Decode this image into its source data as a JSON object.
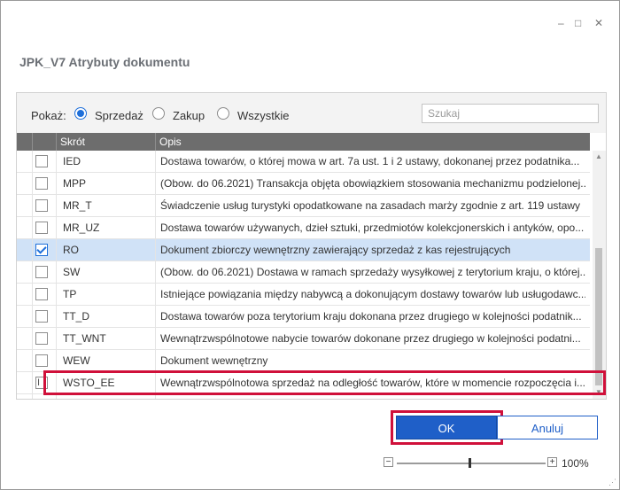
{
  "window": {
    "controls": [
      "–",
      "□",
      "✕"
    ],
    "title": "JPK_V7 Atrybuty dokumentu"
  },
  "filter": {
    "label": "Pokaż:",
    "options": [
      {
        "label": "Sprzedaż",
        "selected": true
      },
      {
        "label": "Zakup",
        "selected": false
      },
      {
        "label": "Wszystkie",
        "selected": false
      }
    ],
    "search_placeholder": "Szukaj"
  },
  "table": {
    "columns": [
      "Skrót",
      "Opis"
    ],
    "rows": [
      {
        "code": "IED",
        "desc": "Dostawa towarów, o której mowa w art. 7a ust. 1 i 2 ustawy, dokonanej przez podatnika...",
        "checked": false
      },
      {
        "code": "MPP",
        "desc": "(Obow. do 06.2021) Transakcja objęta obowiązkiem stosowania mechanizmu podzielonej...",
        "checked": false
      },
      {
        "code": "MR_T",
        "desc": "Świadczenie usług turystyki opodatkowane na zasadach marży zgodnie z art. 119 ustawy",
        "checked": false
      },
      {
        "code": "MR_UZ",
        "desc": "Dostawa towarów używanych, dzieł sztuki, przedmiotów kolekcjonerskich i antyków, opo...",
        "checked": false
      },
      {
        "code": "RO",
        "desc": "Dokument zbiorczy wewnętrzny zawierający sprzedaż z kas rejestrujących",
        "checked": true,
        "selected": true
      },
      {
        "code": "SW",
        "desc": "(Obow. do 06.2021) Dostawa w ramach sprzedaży wysyłkowej z terytorium kraju, o której...",
        "checked": false
      },
      {
        "code": "TP",
        "desc": "Istniejące powiązania między nabywcą a dokonującym dostawy towarów lub usługodawc...",
        "checked": false
      },
      {
        "code": "TT_D",
        "desc": "Dostawa towarów poza terytorium kraju dokonana przez drugiego w kolejności podatnik...",
        "checked": false
      },
      {
        "code": "TT_WNT",
        "desc": "Wewnątrzwspólnotowe nabycie towarów dokonane przez drugiego w kolejności podatni...",
        "checked": false
      },
      {
        "code": "WEW",
        "desc": "Dokument wewnętrzny",
        "checked": false
      },
      {
        "code": "WSTO_EE",
        "desc": "Wewnątrzwspólnotowa sprzedaż na odległość towarów, które w momencie rozpoczęcia i...",
        "checked": false
      }
    ]
  },
  "buttons": {
    "ok": "OK",
    "cancel": "Anuluj"
  },
  "zoom": {
    "minus": "−",
    "plus": "+",
    "level": "100%",
    "fraction": 0.5
  },
  "colors": {
    "accent": "#1f5fc8",
    "highlight": "#d0103a",
    "header": "#6d6d6d",
    "selected_row": "#d0e2f7"
  }
}
